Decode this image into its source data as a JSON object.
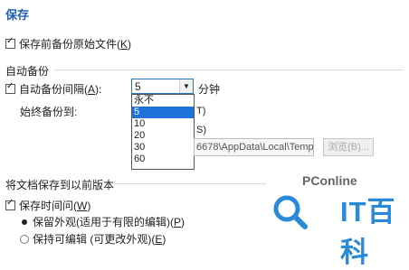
{
  "header": {
    "title": "保存"
  },
  "save_original": {
    "label": "保存前备份原始文件(",
    "key": "K",
    "tail": ")",
    "checked": true
  },
  "autobackup": {
    "section_title": "自动备份",
    "interval_label": "自动备份间隔(",
    "interval_key": "A",
    "interval_tail": "):",
    "interval_value": "5",
    "unit": "分钟",
    "always_backup_to": "始终备份到:",
    "options": [
      "永不",
      "5",
      "10",
      "20",
      "30",
      "60"
    ],
    "selected_index": 1,
    "clipped_1": "T)",
    "clipped_2": "S)",
    "path": "6678\\AppData\\Local\\Temp\\",
    "browse_label": "浏览(B)..."
  },
  "versions": {
    "section_title": "将文档保存到以前版本",
    "save_time_label": "保存时间问(",
    "save_time_key": "W",
    "save_time_tail": ")",
    "radio_keep": "保留外观(适用于有限的编辑)(",
    "radio_keep_key": "P",
    "radio_keep_tail": ")",
    "radio_editable": "保持可编辑 (可更改外观)(",
    "radio_editable_key": "E",
    "radio_editable_tail": ")"
  },
  "watermark": {
    "brand": "PConline",
    "big": "IT百科"
  },
  "colors": {
    "accent": "#1e5fb5",
    "selection": "#1e73d8",
    "logo": "#2b8ad8"
  }
}
